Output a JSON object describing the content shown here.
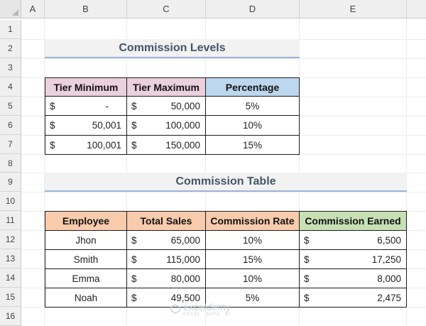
{
  "columns": [
    "A",
    "B",
    "C",
    "D",
    "E"
  ],
  "rows": [
    "1",
    "2",
    "3",
    "4",
    "5",
    "6",
    "7",
    "8",
    "9",
    "10",
    "11",
    "12",
    "13",
    "14",
    "15",
    "16"
  ],
  "commission_levels": {
    "title": "Commission Levels",
    "headers": [
      "Tier Minimum",
      "Tier Maximum",
      "Percentage"
    ],
    "rows": [
      {
        "min_sym": "$",
        "min": "-",
        "max_sym": "$",
        "max": "50,000",
        "pct": "5%"
      },
      {
        "min_sym": "$",
        "min": "50,001",
        "max_sym": "$",
        "max": "100,000",
        "pct": "10%"
      },
      {
        "min_sym": "$",
        "min": "100,001",
        "max_sym": "$",
        "max": "150,000",
        "pct": "15%"
      }
    ]
  },
  "commission_table": {
    "title": "Commission Table",
    "headers": [
      "Employee",
      "Total Sales",
      "Commission Rate",
      "Commission Earned"
    ],
    "rows": [
      {
        "employee": "Jhon",
        "sales_sym": "$",
        "sales": "65,000",
        "rate": "10%",
        "earned_sym": "$",
        "earned": "6,500"
      },
      {
        "employee": "Smith",
        "sales_sym": "$",
        "sales": "115,000",
        "rate": "15%",
        "earned_sym": "$",
        "earned": "17,250"
      },
      {
        "employee": "Emma",
        "sales_sym": "$",
        "sales": "80,000",
        "rate": "10%",
        "earned_sym": "$",
        "earned": "8,000"
      },
      {
        "employee": "Noah",
        "sales_sym": "$",
        "sales": "49,500",
        "rate": "5%",
        "earned_sym": "$",
        "earned": "2,475"
      }
    ]
  },
  "watermark": {
    "brand": "exceldemy",
    "sub": "EXCEL · DATA · BI"
  },
  "colors": {
    "header_pink": "#ead1dc",
    "header_blue": "#bdd7ee",
    "header_orange": "#f8cbad",
    "header_green": "#c6e0b4",
    "title_text": "#44546a",
    "title_underline": "#9bb3d6"
  }
}
